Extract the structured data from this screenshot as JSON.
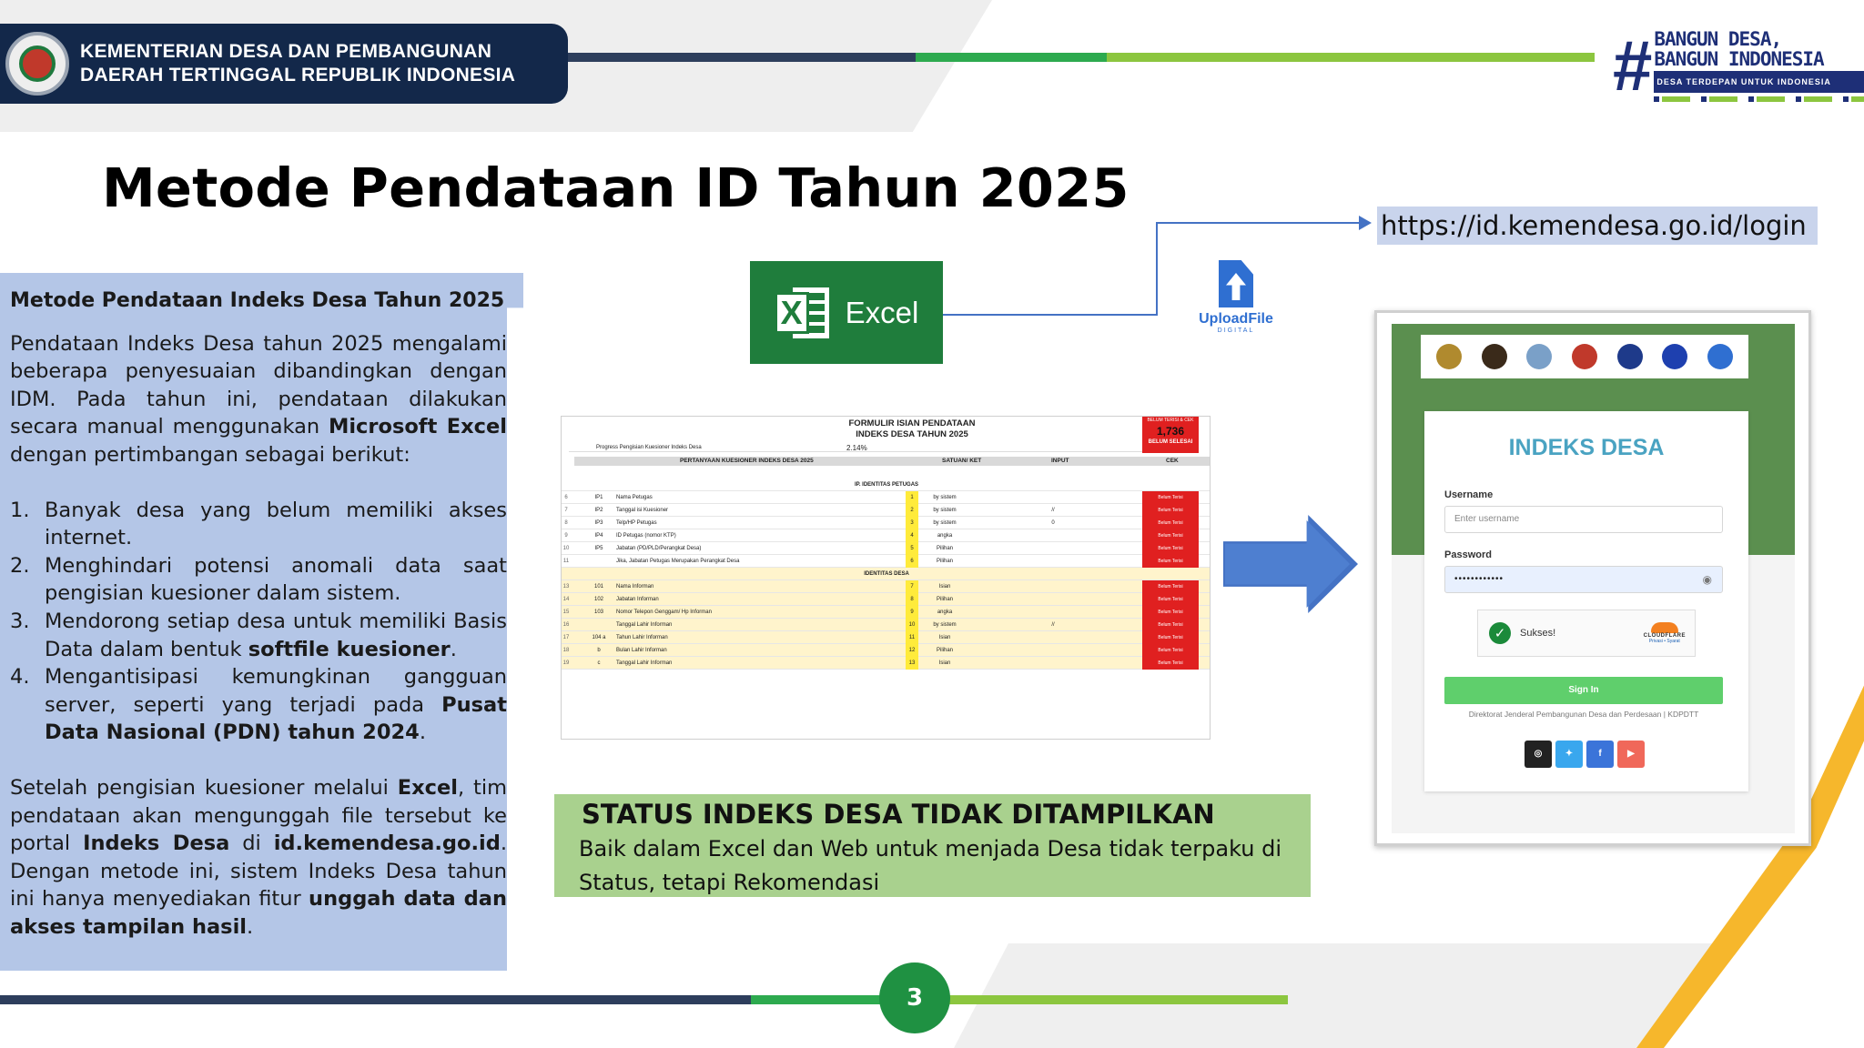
{
  "header": {
    "ministry_line1": "KEMENTERIAN DESA DAN PEMBANGUNAN",
    "ministry_line2": "DAERAH TERTINGGAL REPUBLIK INDONESIA",
    "brand_hash": "#",
    "brand_line1": "BANGUN DESA,",
    "brand_line2": "BANGUN INDONESIA",
    "brand_tagline": "DESA TERDEPAN UNTUK INDONESIA"
  },
  "title": "Metode Pendataan ID Tahun 2025",
  "left_panel": {
    "heading": "Metode Pendataan Indeks Desa Tahun 2025",
    "intro_before": "Pendataan Indeks Desa tahun 2025 mengalami beberapa penyesuaian dibandingkan dengan IDM. Pada tahun ini, pendataan dilakukan secara manual menggunakan ",
    "intro_bold": "Microsoft Excel",
    "intro_after": " dengan pertimbangan sebagai berikut:",
    "items": [
      {
        "num": "1.",
        "text": "Banyak desa yang belum memiliki akses internet."
      },
      {
        "num": "2.",
        "text": "Menghindari potensi anomali data saat pengisian kuesioner dalam sistem."
      },
      {
        "num": "3.",
        "text_before": "Mendorong setiap desa untuk memiliki Basis Data dalam bentuk ",
        "text_bold": "softfile kuesioner",
        "text_after": "."
      },
      {
        "num": "4.",
        "text_before": "Mengantisipasi kemungkinan gangguan server, seperti yang terjadi pada ",
        "text_bold": "Pusat Data Nasional (PDN) tahun 2024",
        "text_after": "."
      }
    ],
    "closing": {
      "p1": "Setelah pengisian kuesioner melalui ",
      "b1": "Excel",
      "p2": ", tim pendataan akan mengunggah file tersebut ke portal ",
      "b2": "Indeks Desa",
      "p3": " di ",
      "b3": "id.kemendesa.go.id",
      "p4": ". Dengan metode ini, sistem Indeks Desa tahun ini hanya menyediakan fitur ",
      "b4": "unggah data dan akses tampilan hasil",
      "p5": "."
    }
  },
  "excel_badge": {
    "icon": "excel-icon",
    "label": "Excel"
  },
  "upload": {
    "icon": "upload-file-icon",
    "label": "UploadFile",
    "sub": "DIGITAL"
  },
  "login_url": "https://id.kemendesa.go.id/login",
  "spreadsheet": {
    "title_line1": "FORMULIR ISIAN PENDATAAN",
    "title_line2": "INDEKS DESA TAHUN 2025",
    "progress_label": "Progress Pengisian Kuesioner Indeks Desa",
    "progress_value": "2.14%",
    "counter_label": "BELUM TERISI & CEK",
    "counter_value": "1,736",
    "counter_status": "BELUM SELESAI",
    "head_question": "PERTANYAAN KUESIONER INDEKS DESA 2025",
    "head_unit": "SATUAN/ KET",
    "head_input": "INPUT",
    "head_check": "CEK",
    "section1": "IP. IDENTITAS PETUGAS",
    "section2": "IDENTITAS DESA",
    "rows": [
      {
        "rn": "6",
        "code": "IP1",
        "label": "Nama Petugas",
        "no": "1",
        "unit": "by sistem",
        "input": "",
        "cek": "Belum Terisi",
        "yellow": false
      },
      {
        "rn": "7",
        "code": "IP2",
        "label": "Tanggal isi Kuesioner",
        "no": "2",
        "unit": "by sistem",
        "input": "//",
        "cek": "Belum Terisi",
        "yellow": false
      },
      {
        "rn": "8",
        "code": "IP3",
        "label": "Telp/HP Petugas",
        "no": "3",
        "unit": "by sistem",
        "input": "0",
        "cek": "Belum Terisi",
        "yellow": false
      },
      {
        "rn": "9",
        "code": "IP4",
        "label": "ID Petugas (nomor KTP)",
        "no": "4",
        "unit": "angka",
        "input": "",
        "cek": "Belum Terisi",
        "yellow": false
      },
      {
        "rn": "10",
        "code": "IP5",
        "label": "Jabatan (PD/PLD/Perangkat Desa)",
        "no": "5",
        "unit": "Pilihan",
        "input": "",
        "cek": "Belum Terisi",
        "yellow": false
      },
      {
        "rn": "11",
        "code": "",
        "label": "Jika, Jabatan Petugas Merupakan Perangkat Desa",
        "no": "6",
        "unit": "Pilihan",
        "input": "",
        "cek": "Belum Terisi",
        "yellow": false
      },
      {
        "rn": "13",
        "code": "101",
        "label": "Nama Informan",
        "no": "7",
        "unit": "Isian",
        "input": "",
        "cek": "Belum Terisi",
        "yellow": true
      },
      {
        "rn": "14",
        "code": "102",
        "label": "Jabatan Informan",
        "no": "8",
        "unit": "Pilihan",
        "input": "",
        "cek": "Belum Terisi",
        "yellow": true
      },
      {
        "rn": "15",
        "code": "103",
        "label": "Nomor Telepon Genggam/ Hp Informan",
        "no": "9",
        "unit": "angka",
        "input": "",
        "cek": "Belum Terisi",
        "yellow": true
      },
      {
        "rn": "16",
        "code": "",
        "label": "Tanggal Lahir Informan",
        "no": "10",
        "unit": "by sistem",
        "input": "//",
        "cek": "Belum Terisi",
        "yellow": true
      },
      {
        "rn": "17",
        "code": "104 a",
        "label": "Tahun Lahir Informan",
        "no": "11",
        "unit": "Isian",
        "input": "",
        "cek": "Belum Terisi",
        "yellow": true
      },
      {
        "rn": "18",
        "code": "b",
        "label": "Bulan Lahir Informan",
        "no": "12",
        "unit": "Pilihan",
        "input": "",
        "cek": "Belum Terisi",
        "yellow": true
      },
      {
        "rn": "19",
        "code": "c",
        "label": "Tanggal Lahir Informan",
        "no": "13",
        "unit": "Isian",
        "input": "",
        "cek": "Belum Terisi",
        "yellow": true
      }
    ]
  },
  "status_box": {
    "title": "STATUS INDEKS DESA TIDAK DITAMPILKAN",
    "desc": "Baik dalam Excel dan Web untuk menjada Desa tidak terpaku di Status, tetapi Rekomendasi"
  },
  "login_page": {
    "brand": "INDEKS DESA",
    "username_label": "Username",
    "username_placeholder": "Enter username",
    "password_label": "Password",
    "password_value": "••••••••••••",
    "captcha_text": "Sukses!",
    "cloudflare_name": "CLOUDFLARE",
    "cloudflare_links": "Privasi • Syarat",
    "signin_label": "Sign In",
    "footer": "Direktorat Jenderal Pembangunan Desa dan Perdesaan | KDPDTT",
    "logo_icons": [
      "garuda-logo-icon",
      "agency-logo-icon",
      "bulog-logo-icon",
      "kemendesa-logo-icon",
      "bps-logo-icon",
      "kemenkeu-logo-icon",
      "digital-logo-icon"
    ],
    "social_icons": [
      {
        "name": "instagram-icon",
        "glyph": "◎",
        "color": "#222222"
      },
      {
        "name": "twitter-icon",
        "glyph": "✦",
        "color": "#39a7ee"
      },
      {
        "name": "facebook-icon",
        "glyph": "f",
        "color": "#3b74d9"
      },
      {
        "name": "youtube-icon",
        "glyph": "▶",
        "color": "#f0685a"
      }
    ]
  },
  "page_number": "3"
}
